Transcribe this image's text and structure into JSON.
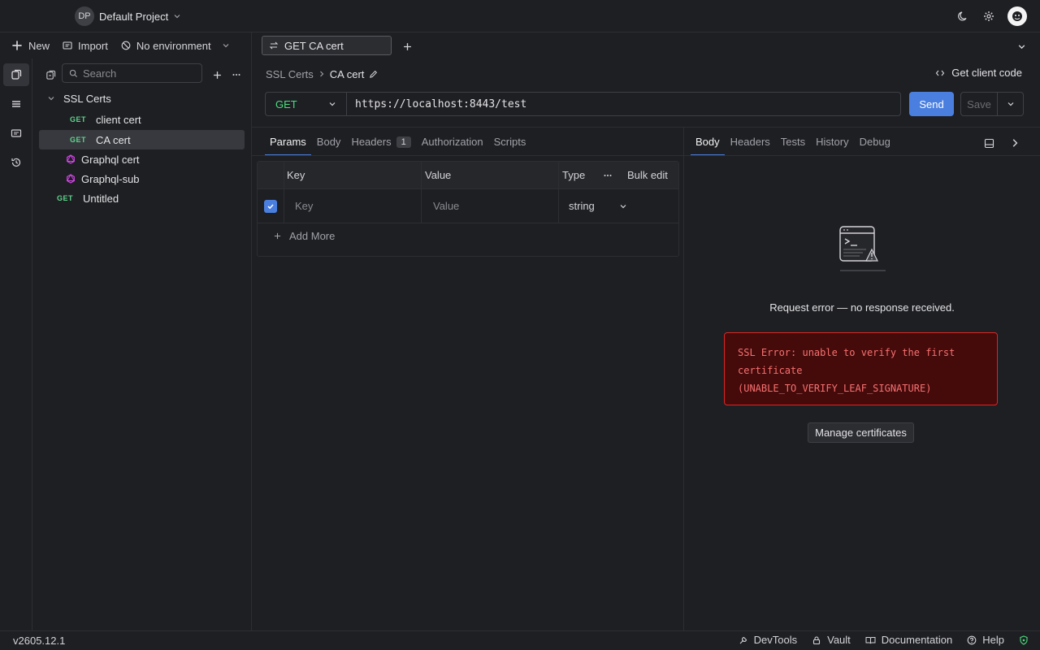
{
  "header": {
    "project_initials": "DP",
    "project_name": "Default Project"
  },
  "toolbar": {
    "new_label": "New",
    "import_label": "Import",
    "environment_label": "No environment"
  },
  "tabs": [
    {
      "label": "GET CA cert"
    }
  ],
  "sidebar": {
    "search_placeholder": "Search",
    "items": [
      {
        "label": "SSL Certs",
        "type": "folder"
      },
      {
        "method": "GET",
        "label": "client cert"
      },
      {
        "method": "GET",
        "label": "CA cert"
      },
      {
        "label": "Graphql cert",
        "type": "graphql"
      },
      {
        "label": "Graphql-sub",
        "type": "graphql"
      },
      {
        "method": "GET",
        "label": "Untitled"
      }
    ]
  },
  "request": {
    "breadcrumb_folder": "SSL Certs",
    "breadcrumb_name": "CA cert",
    "client_code_label": "Get client code",
    "method": "GET",
    "url": "https://localhost:8443/test",
    "send_label": "Send",
    "save_label": "Save",
    "tabs": [
      {
        "label": "Params"
      },
      {
        "label": "Body"
      },
      {
        "label": "Headers",
        "badge": "1"
      },
      {
        "label": "Authorization"
      },
      {
        "label": "Scripts"
      }
    ],
    "params": {
      "headers": {
        "key": "Key",
        "value": "Value",
        "type": "Type",
        "bulk": "Bulk edit"
      },
      "row": {
        "key_placeholder": "Key",
        "value_placeholder": "Value",
        "type": "string"
      },
      "add_more": "Add More"
    }
  },
  "response": {
    "tabs": [
      {
        "label": "Body"
      },
      {
        "label": "Headers"
      },
      {
        "label": "Tests"
      },
      {
        "label": "History"
      },
      {
        "label": "Debug"
      }
    ],
    "error_title": "Request error — no response received.",
    "error_message": "SSL Error: unable to verify the first certificate (UNABLE_TO_VERIFY_LEAF_SIGNATURE)",
    "manage_label": "Manage certificates"
  },
  "status": {
    "version": "v2605.12.1",
    "devtools": "DevTools",
    "vault": "Vault",
    "documentation": "Documentation",
    "help": "Help"
  },
  "colors": {
    "accent": "#4a7fe0",
    "get_method": "#4ade80",
    "graphql": "#d946ef",
    "error_bg": "#450a0a",
    "error_border": "#dc2626",
    "error_text": "#f87171"
  }
}
